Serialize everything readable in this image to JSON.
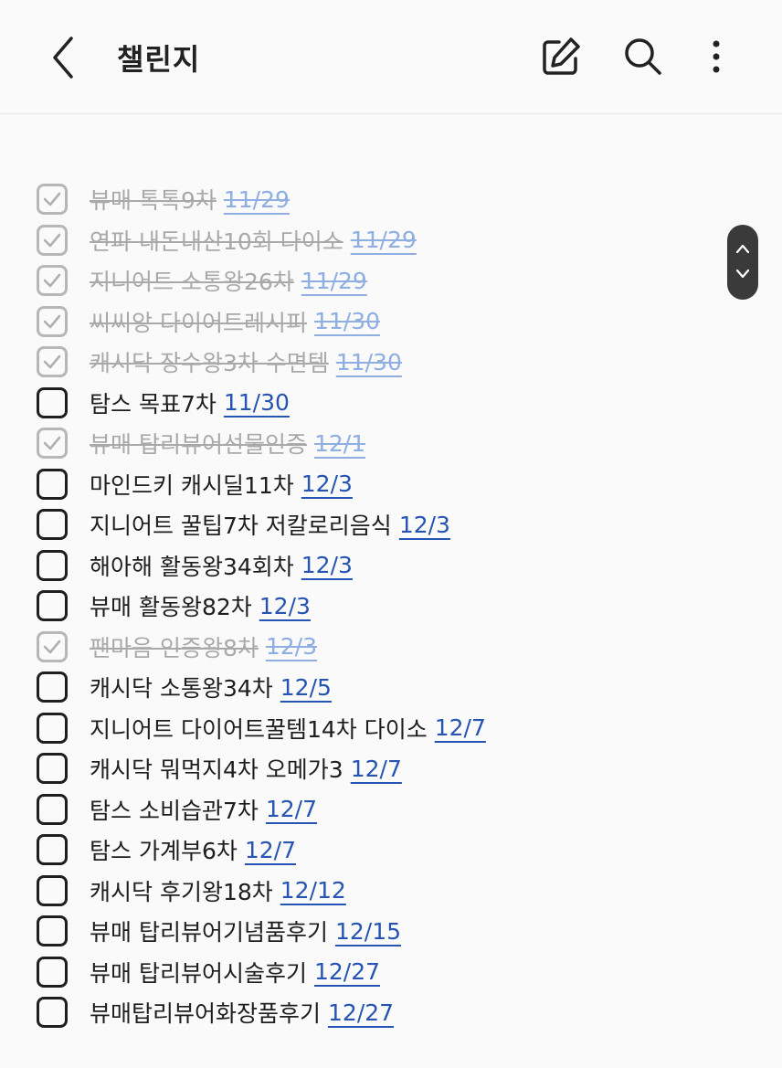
{
  "header": {
    "title": "챌린지",
    "icons": [
      "back-icon",
      "edit-icon",
      "search-icon",
      "more-vertical-icon"
    ]
  },
  "colors": {
    "date_link": "#2554b3",
    "checked_box": "#b7b7b7",
    "scroll_pill": "#3a3a3a"
  },
  "checklist": [
    {
      "text": "뷰매 톡톡9차",
      "date": "11/29",
      "checked": true
    },
    {
      "text": "연파 내돈내산10회 다이소",
      "date": "11/29",
      "checked": true
    },
    {
      "text": "지니어트 소통왕26차",
      "date": "11/29",
      "checked": true
    },
    {
      "text": "씨씨앙 다이어트레시피",
      "date": "11/30",
      "checked": true
    },
    {
      "text": "캐시닥 장수왕3차 수면템",
      "date": "11/30",
      "checked": true
    },
    {
      "text": "탐스 목표7차",
      "date": "11/30",
      "checked": false
    },
    {
      "text": "뷰매 탑리뷰어선물인증",
      "date": "12/1",
      "checked": true
    },
    {
      "text": "마인드키 캐시딜11차",
      "date": "12/3",
      "checked": false
    },
    {
      "text": "지니어트 꿀팁7차 저칼로리음식",
      "date": "12/3",
      "checked": false
    },
    {
      "text": "해아해 활동왕34회차",
      "date": "12/3",
      "checked": false
    },
    {
      "text": "뷰매 활동왕82차",
      "date": "12/3",
      "checked": false
    },
    {
      "text": "팬마음 인증왕8차",
      "date": "12/3",
      "checked": true
    },
    {
      "text": "캐시닥 소통왕34차",
      "date": "12/5",
      "checked": false
    },
    {
      "text": "지니어트 다이어트꿀템14차 다이소",
      "date": "12/7",
      "checked": false
    },
    {
      "text": "캐시닥 뭐먹지4차 오메가3",
      "date": "12/7",
      "checked": false
    },
    {
      "text": "탐스 소비습관7차",
      "date": "12/7",
      "checked": false
    },
    {
      "text": "탐스 가계부6차",
      "date": "12/7",
      "checked": false
    },
    {
      "text": "캐시닥 후기왕18차",
      "date": "12/12",
      "checked": false
    },
    {
      "text": "뷰매 탑리뷰어기념품후기",
      "date": "12/15",
      "checked": false
    },
    {
      "text": "뷰매 탑리뷰어시술후기",
      "date": "12/27",
      "checked": false
    },
    {
      "text": "뷰매탑리뷰어화장품후기",
      "date": "12/27",
      "checked": false
    }
  ]
}
